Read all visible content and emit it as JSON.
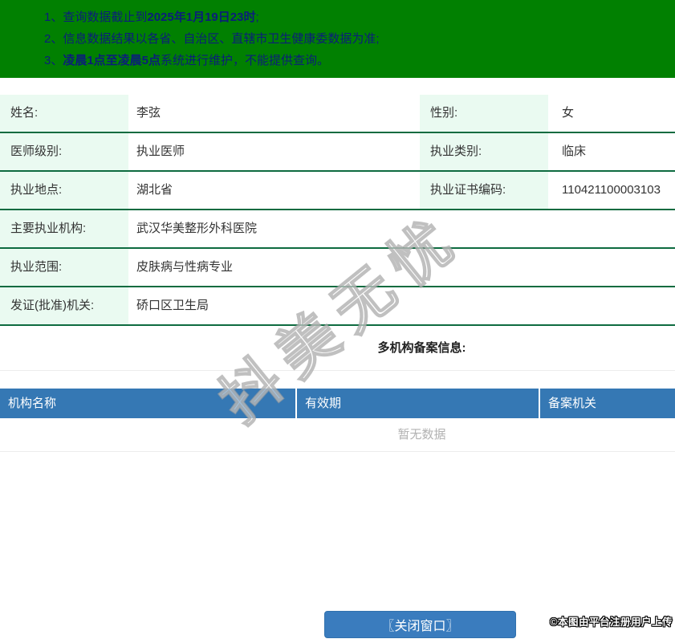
{
  "banner": {
    "items": [
      {
        "num": "1、",
        "pre": "查询数据截止到",
        "bold": "2025年1月19日23时",
        "post": ";"
      },
      {
        "num": "2、",
        "pre": "信息数据结果以各省、自治区、直辖市卫生健康委数据为准;",
        "bold": "",
        "post": ""
      },
      {
        "num": "3、",
        "pre": "",
        "bold": "凌晨1点至凌晨5点",
        "post": "系统进行维护，不能提供查询。"
      }
    ]
  },
  "profile": {
    "rows": [
      {
        "l1": "姓名:",
        "v1": "李弦",
        "l2": "性别:",
        "v2": "女"
      },
      {
        "l1": "医师级别:",
        "v1": "执业医师",
        "l2": "执业类别:",
        "v2": "临床"
      },
      {
        "l1": "执业地点:",
        "v1": "湖北省",
        "l2": "执业证书编码:",
        "v2": "110421100003103"
      },
      {
        "l1": "主要执业机构:",
        "v1": "武汉华美整形外科医院"
      },
      {
        "l1": "执业范围:",
        "v1": "皮肤病与性病专业"
      },
      {
        "l1": "发证(批准)机关:",
        "v1": "硚口区卫生局"
      }
    ]
  },
  "records": {
    "heading": "多机构备案信息:",
    "columns": [
      "机构名称",
      "有效期",
      "备案机关"
    ],
    "empty_text": "暂无数据"
  },
  "footer": {
    "close_button": "〖关闭窗口〗",
    "copyright": "©本图由平台注册用户上传"
  },
  "watermark": "抖美无忧",
  "colors": {
    "banner_bg": "#018001",
    "banner_text": "#0b1e7a",
    "label_cell_bg": "#eafaf1",
    "row_border_green": "#0e6b40",
    "records_header_bg": "#3578b4",
    "button_bg": "#3a7cbe",
    "empty_text_gray": "#b2b2b2"
  }
}
